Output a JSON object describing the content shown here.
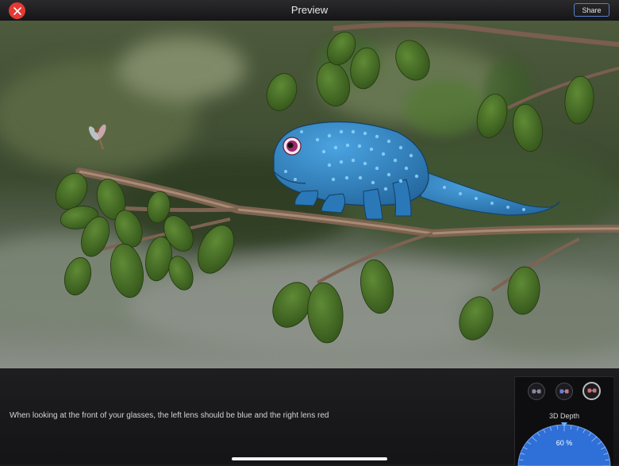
{
  "header": {
    "title": "Preview",
    "share_label": "Share"
  },
  "bottom": {
    "hint": "When looking at the front of your glasses, the left lens should be blue and the right lens red"
  },
  "depth": {
    "label": "3D Depth",
    "value_text": "60 %",
    "value": 0.6
  },
  "modes": [
    {
      "name": "anaglyph-mode-1-icon",
      "active": false
    },
    {
      "name": "anaglyph-mode-2-icon",
      "active": false
    },
    {
      "name": "anaglyph-mode-3-icon",
      "active": true
    }
  ],
  "colors": {
    "close": "#e53935",
    "share_border": "#5a7fc9",
    "dial": "#2f6fd8",
    "chameleon": "#3a8fd0"
  }
}
